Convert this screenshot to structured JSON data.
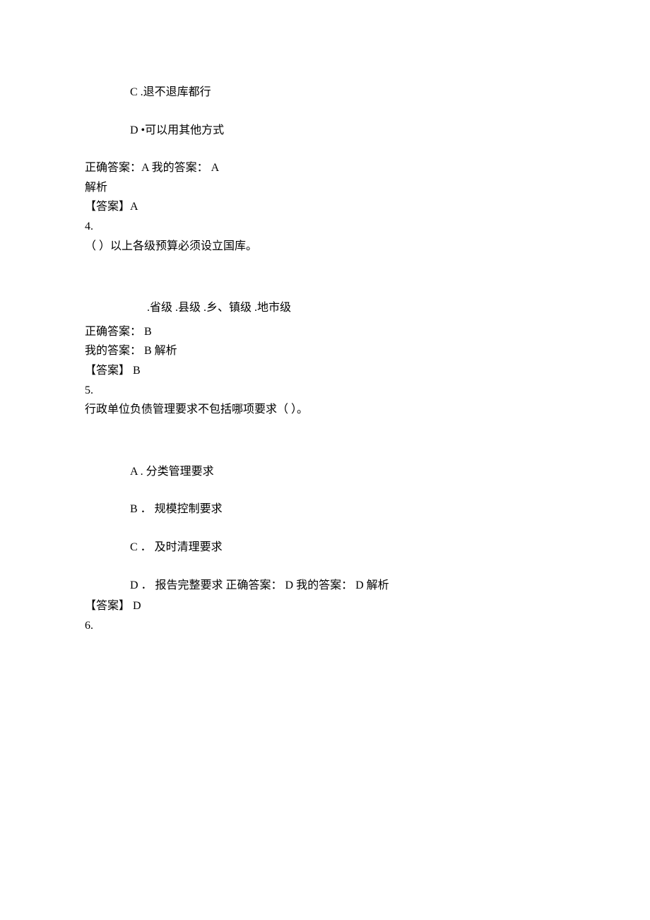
{
  "q3": {
    "optC": "C .退不退库都行",
    "optD": "D •可以用其他方式",
    "correct": "正确答案：A 我的答案： A",
    "jiexi": "解析",
    "answer": "【答案】A"
  },
  "q4": {
    "num": "4.",
    "stem": "（ ）以上各级预算必须设立国库。",
    "options": ".省级  .县级  .乡、镇级  .地市级",
    "correct": "正确答案： B",
    "mine": "我的答案： B 解析",
    "answer": "【答案】 B"
  },
  "q5": {
    "num": "5.",
    "stem": "行政单位负债管理要求不包括哪项要求（ ）。",
    "optA": "A .  分类管理要求",
    "optB": "B ． 规模控制要求",
    "optC": "C ． 及时清理要求",
    "optD": "D ． 报告完整要求  正确答案：  D 我的答案：  D 解析",
    "answer": "【答案】 D"
  },
  "q6": {
    "num": "6."
  }
}
